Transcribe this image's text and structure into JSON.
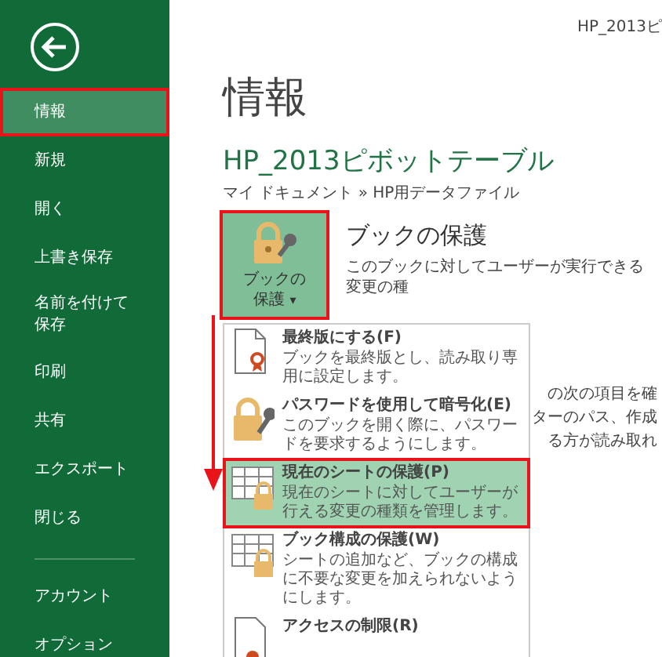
{
  "window": {
    "title": "HP_2013ピ"
  },
  "sidebar": {
    "items": [
      {
        "label": "情報",
        "selected": true,
        "annotated": true
      },
      {
        "label": "新規",
        "selected": false,
        "annotated": false
      },
      {
        "label": "開く",
        "selected": false,
        "annotated": false
      },
      {
        "label": "上書き保存",
        "selected": false,
        "annotated": false
      },
      {
        "label": "名前を付けて保存",
        "selected": false,
        "annotated": false
      },
      {
        "label": "印刷",
        "selected": false,
        "annotated": false
      },
      {
        "label": "共有",
        "selected": false,
        "annotated": false
      },
      {
        "label": "エクスポート",
        "selected": false,
        "annotated": false
      },
      {
        "label": "閉じる",
        "selected": false,
        "annotated": false
      },
      {
        "label": "アカウント",
        "selected": false,
        "annotated": false
      },
      {
        "label": "オプション",
        "selected": false,
        "annotated": false
      }
    ]
  },
  "page_title": "情報",
  "file_name": "HP_2013ピボットテーブル",
  "path": "マイ ドキュメント » HP用データファイル",
  "protect_section": {
    "button_label": "ブックの保護",
    "caret": "▾",
    "annotated": true,
    "heading": "ブックの保護",
    "description": "このブックに対してユーザーが実行できる変更の種"
  },
  "background_lines": [
    "の次の項目を確",
    "ターのパス、作成",
    "る方が読み取れ"
  ],
  "menu": {
    "items": [
      {
        "kind": "final",
        "label": "最終版にする(F)",
        "description": "ブックを最終版とし、読み取り専用に設定します。",
        "selected": false,
        "annotated": false
      },
      {
        "kind": "encrypt",
        "label": "パスワードを使用して暗号化(E)",
        "description": "このブックを開く際に、パスワードを要求するようにします。",
        "selected": false,
        "annotated": false
      },
      {
        "kind": "sheet",
        "label": "現在のシートの保護(P)",
        "description": "現在のシートに対してユーザーが行える変更の種類を管理します。",
        "selected": true,
        "annotated": true
      },
      {
        "kind": "structure",
        "label": "ブック構成の保護(W)",
        "description": "シートの追加など、ブックの構成に不要な変更を加えられないようにします。",
        "selected": false,
        "annotated": false
      },
      {
        "kind": "access",
        "label": "アクセスの制限(R)",
        "selected": false,
        "annotated": false
      }
    ]
  }
}
